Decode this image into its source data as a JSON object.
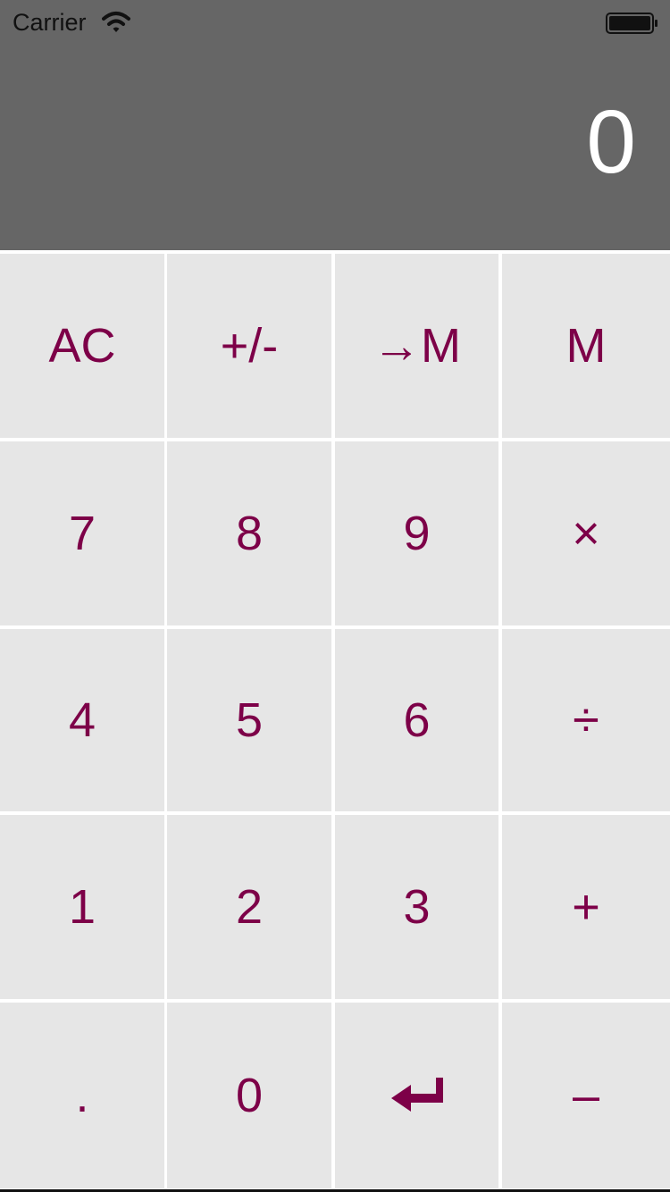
{
  "status_bar": {
    "carrier": "Carrier",
    "wifi_icon": "wifi-icon",
    "battery_icon": "battery-icon"
  },
  "display": {
    "value": "0"
  },
  "keys": [
    {
      "id": "clear",
      "label": "AC",
      "name": "clear-button"
    },
    {
      "id": "negate",
      "label": "+/-",
      "name": "negate-button"
    },
    {
      "id": "store_memory",
      "label": "→M",
      "name": "store-memory-button"
    },
    {
      "id": "recall_memory",
      "label": "M",
      "name": "recall-memory-button"
    },
    {
      "id": "d7",
      "label": "7",
      "name": "digit-7-button"
    },
    {
      "id": "d8",
      "label": "8",
      "name": "digit-8-button"
    },
    {
      "id": "d9",
      "label": "9",
      "name": "digit-9-button"
    },
    {
      "id": "multiply",
      "label": "×",
      "name": "multiply-button"
    },
    {
      "id": "d4",
      "label": "4",
      "name": "digit-4-button"
    },
    {
      "id": "d5",
      "label": "5",
      "name": "digit-5-button"
    },
    {
      "id": "d6",
      "label": "6",
      "name": "digit-6-button"
    },
    {
      "id": "divide",
      "label": "÷",
      "name": "divide-button"
    },
    {
      "id": "d1",
      "label": "1",
      "name": "digit-1-button"
    },
    {
      "id": "d2",
      "label": "2",
      "name": "digit-2-button"
    },
    {
      "id": "d3",
      "label": "3",
      "name": "digit-3-button"
    },
    {
      "id": "add",
      "label": "+",
      "name": "add-button"
    },
    {
      "id": "decimal",
      "label": ".",
      "name": "decimal-button"
    },
    {
      "id": "d0",
      "label": "0",
      "name": "digit-0-button"
    },
    {
      "id": "enter",
      "label": "",
      "name": "enter-button",
      "icon": "enter-return-icon"
    },
    {
      "id": "subtract",
      "label": "–",
      "name": "subtract-button"
    }
  ],
  "colors": {
    "display_background": "#666666",
    "display_text": "#ffffff",
    "key_background": "#e6e6e6",
    "key_text": "#7d0048",
    "grid_line": "#ffffff"
  }
}
